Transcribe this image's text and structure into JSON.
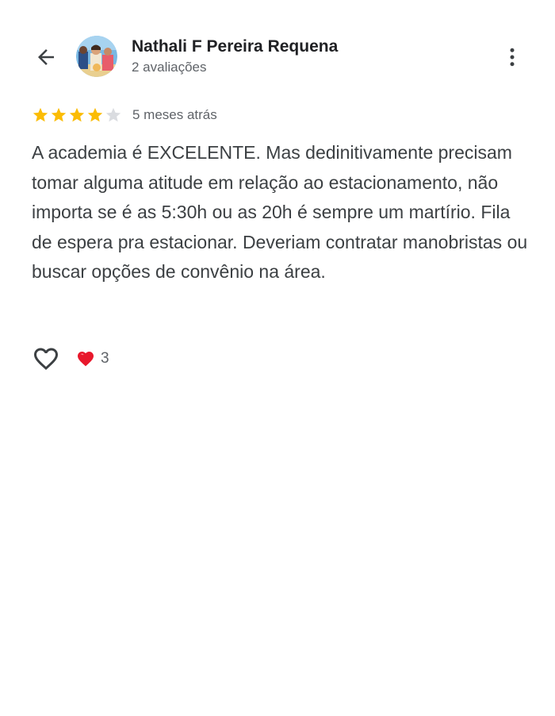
{
  "header": {
    "back_icon": "arrow-back-icon",
    "avatar_icon": "avatar",
    "more_icon": "more-vert-icon"
  },
  "user": {
    "name": "Nathali F Pereira Requena",
    "reviews": "2 avaliações"
  },
  "review": {
    "rating": 4,
    "max_rating": 5,
    "time_ago": "5 meses atrás",
    "text": "A academia é EXCELENTE. Mas dedinitivamente precisam tomar alguma atitude em relação ao estacionamento, não importa se é as 5:30h ou as 20h é sempre um martírio. Fila de espera pra estacionar. Deveriam contratar manobristas ou buscar opções de convênio na área."
  },
  "reactions": {
    "like_icon": "heart-outline-icon",
    "reaction_icon": "heart-filled-icon",
    "count": "3"
  },
  "colors": {
    "star_filled": "#FBBC04",
    "star_empty": "#DADCE0",
    "heart_red": "#E8182C",
    "text_primary": "#202124",
    "text_secondary": "#5f6368"
  }
}
